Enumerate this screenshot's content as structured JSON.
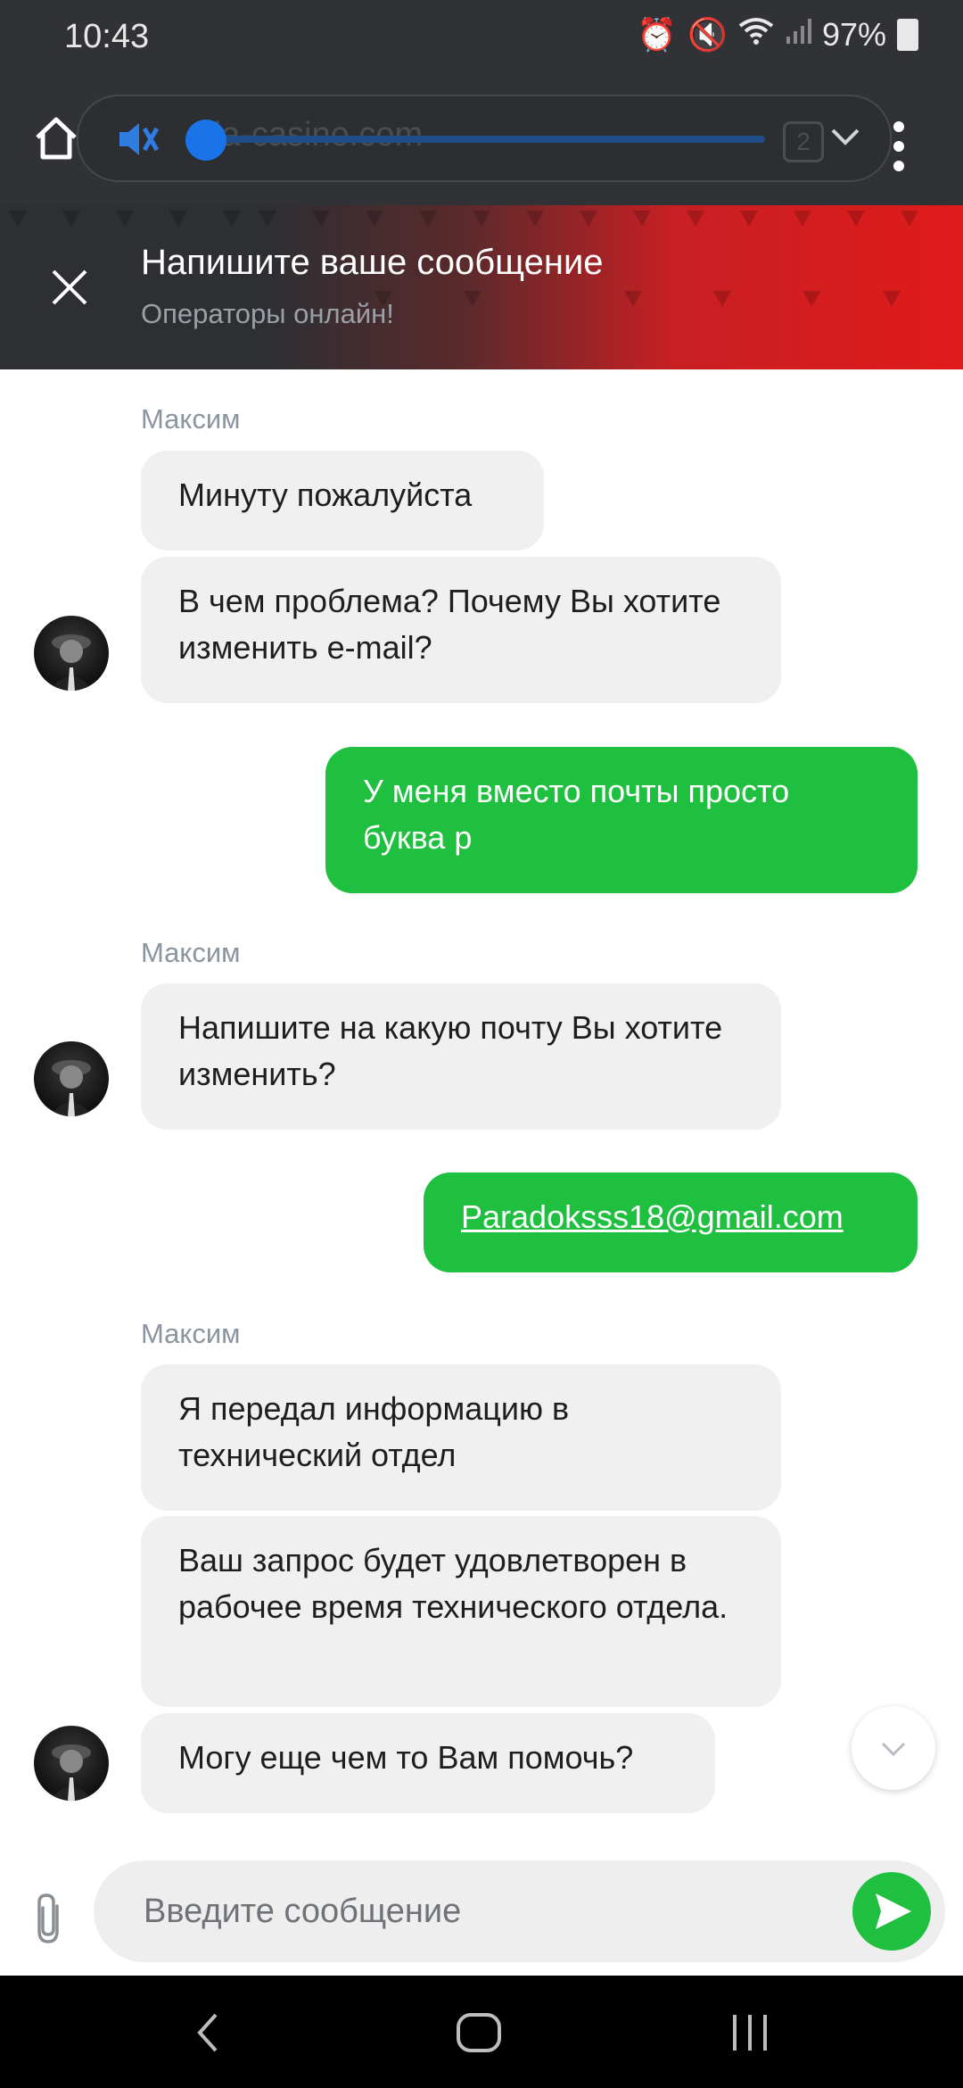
{
  "status_bar": {
    "time": "10:43",
    "battery": "97%"
  },
  "browser": {
    "url": "afia-casino.com",
    "tab_count": "2"
  },
  "chat_header": {
    "title": "Напишите ваше сообщение",
    "subtitle": "Операторы онлайн!"
  },
  "messages": [
    {
      "sender": "Максим",
      "text": "Минуту пожалуйста"
    },
    {
      "text": "В чем проблема? Почему Вы хотите изменить e-mail?"
    },
    {
      "text": "У меня вместо почты просто буква р"
    },
    {
      "sender": "Максим",
      "text": "Напишите на какую почту Вы хотите изменить?"
    },
    {
      "text": "Paradoksss18@gmail.com"
    },
    {
      "sender": "Максим",
      "text": "Я передал информацию в технический отдел"
    },
    {
      "text": "Ваш запрос будет удовлетворен в рабочее время технического отдела."
    },
    {
      "text": "Могу еще чем то Вам помочь?"
    }
  ],
  "input": {
    "placeholder": "Введите сообщение"
  },
  "colors": {
    "outgoing_bubble": "#1fbf3f",
    "incoming_bubble": "#f0f0f0",
    "header_red": "#e01b1b"
  }
}
